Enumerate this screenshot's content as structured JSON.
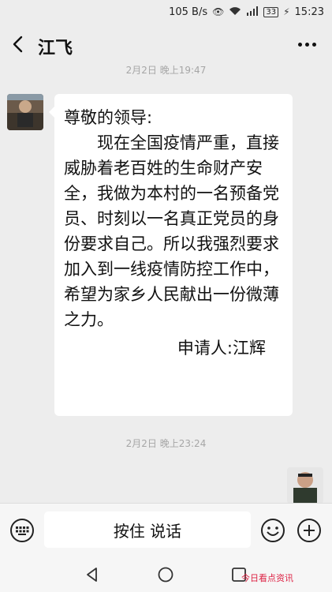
{
  "status_bar": {
    "speed": "105 B/s",
    "battery": "33",
    "time": "15:23"
  },
  "header": {
    "title": "江飞"
  },
  "timestamps": {
    "top": "2月2日 晚上19:47",
    "bottom": "2月2日 晚上23:24"
  },
  "message": {
    "greeting": "尊敬的领导:",
    "body": "现在全国疫情严重，直接威胁着老百姓的生命财产安全，我做为本村的一名预备党员、时刻以一名真正党员的身份要求自己。所以我强烈要求加入到一线疫情防控工作中，希望为家乡人民献出一份微薄之力。",
    "signature": "申请人:江辉"
  },
  "input_bar": {
    "hold_to_talk": "按住 说话"
  },
  "watermark": "今日看点资讯"
}
